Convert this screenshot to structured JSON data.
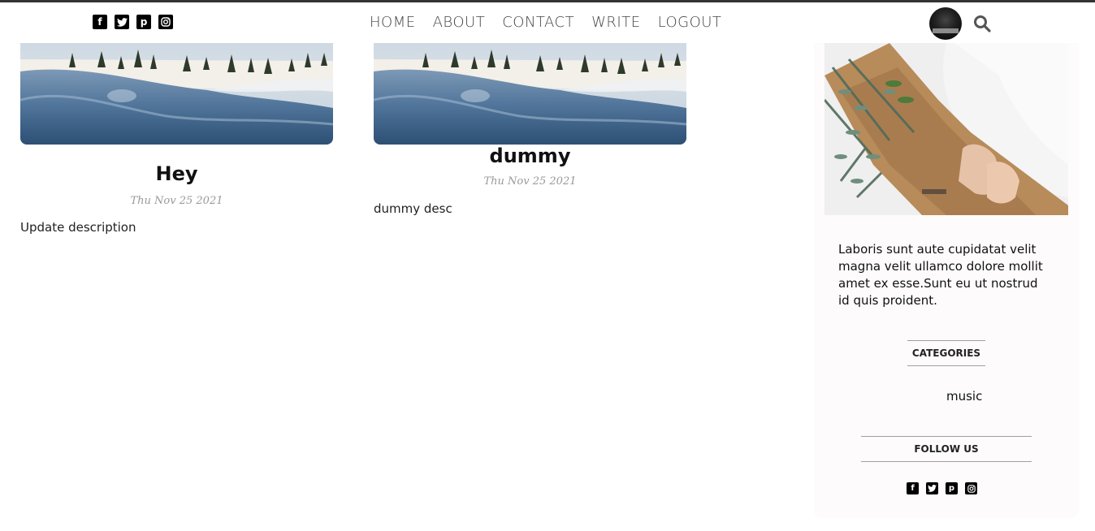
{
  "header": {
    "social_icons": [
      "facebook-square-icon",
      "twitter-square-icon",
      "pinterest-square-icon",
      "instagram-square-icon"
    ],
    "nav": [
      "HOME",
      "ABOUT",
      "CONTACT",
      "WRITE",
      "LOGOUT"
    ]
  },
  "posts": [
    {
      "title": "Hey",
      "date": "Thu Nov 25 2021",
      "desc": "Update description"
    },
    {
      "title": "dummy",
      "date": "Thu Nov 25 2021",
      "desc": "dummy desc"
    }
  ],
  "sidebar": {
    "about_text": "Laboris sunt aute cupidatat velit magna velit ullamco dolore mollit amet ex esse.Sunt eu ut nostrud id quis proident.",
    "categories_title": "CATEGORIES",
    "categories": [
      "music"
    ],
    "follow_title": "FOLLOW US"
  },
  "colors": {
    "topline": "#333333",
    "sidebar_bg": "#fdfbfb",
    "nav_text": "#444444",
    "date_text": "#999999"
  }
}
